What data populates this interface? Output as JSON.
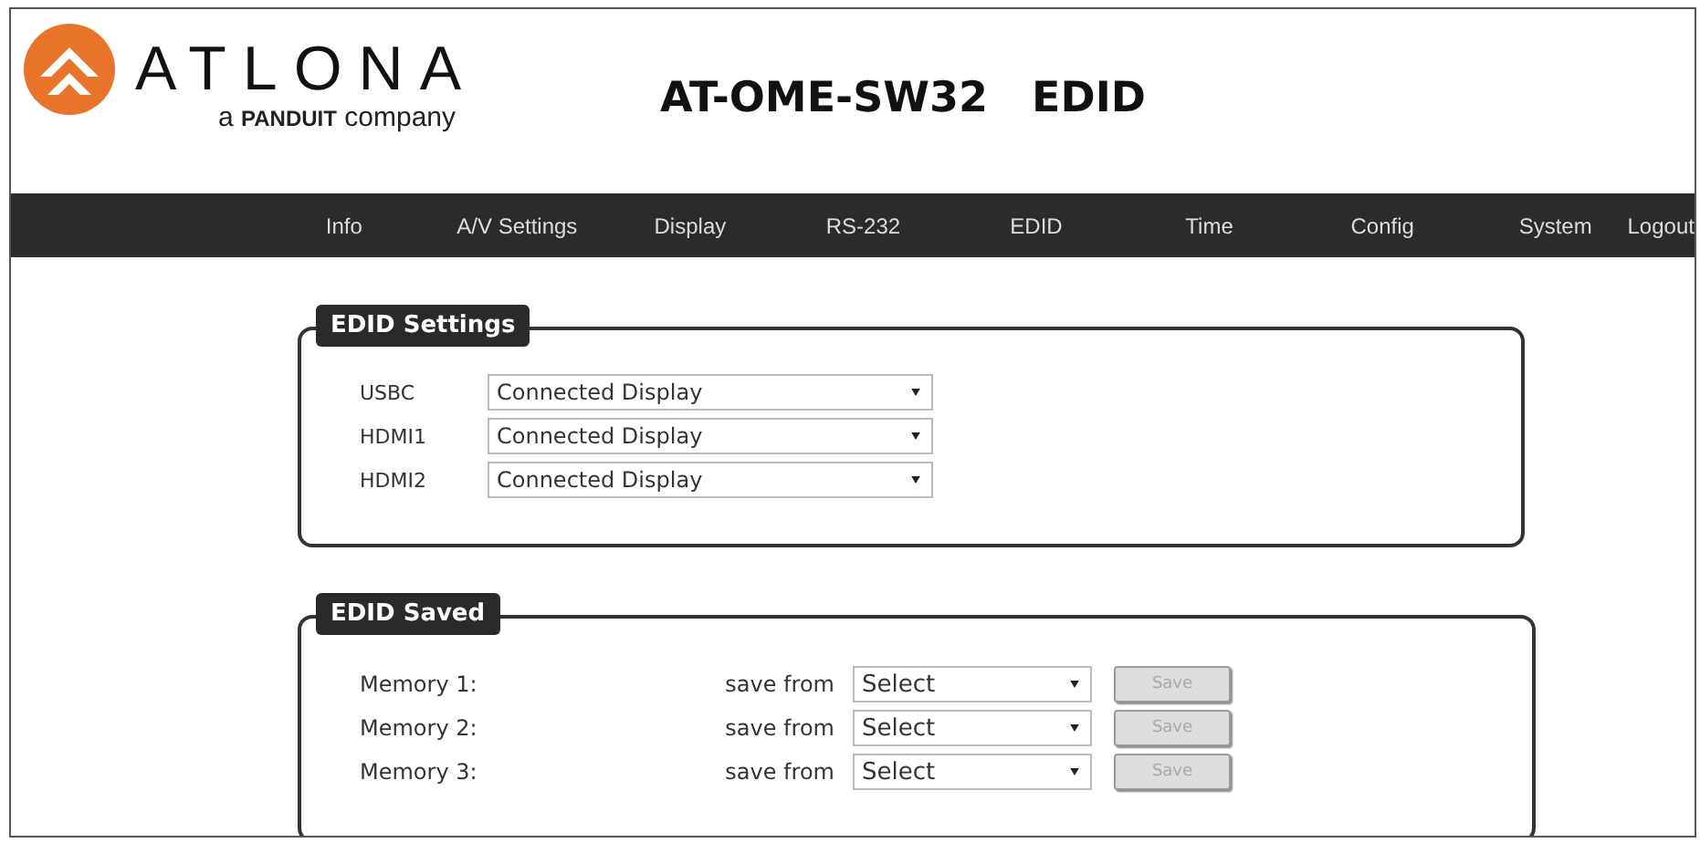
{
  "header": {
    "brand": "ATLONA",
    "tagline_prefix": "a",
    "tagline_brand": "PANDUIT",
    "tagline_suffix": "company",
    "title": "AT-OME-SW32   EDID"
  },
  "nav": [
    "Info",
    "A/V Settings",
    "Display",
    "RS-232",
    "EDID",
    "Time",
    "Config",
    "System",
    "Logout"
  ],
  "edid_settings": {
    "title": "EDID Settings",
    "rows": [
      {
        "label": "USBC",
        "value": "Connected Display"
      },
      {
        "label": "HDMI1",
        "value": "Connected Display"
      },
      {
        "label": "HDMI2",
        "value": "Connected Display"
      }
    ]
  },
  "edid_saved": {
    "title": "EDID Saved",
    "rows": [
      {
        "label": "Memory 1:",
        "source_label": "save from",
        "value": "Select",
        "button": "Save",
        "disabled": true
      },
      {
        "label": "Memory 2:",
        "source_label": "save from",
        "value": "Select",
        "button": "Save",
        "disabled": true
      },
      {
        "label": "Memory 3:",
        "source_label": "save from",
        "value": "Select",
        "button": "Save",
        "disabled": true
      }
    ]
  }
}
